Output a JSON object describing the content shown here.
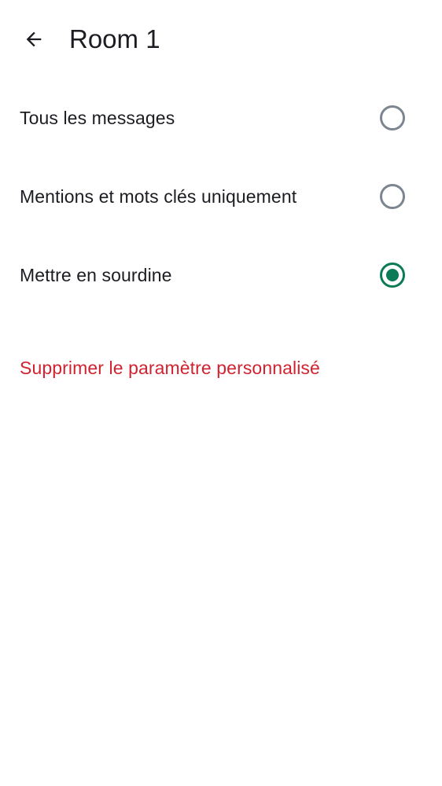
{
  "header": {
    "title": "Room 1",
    "back_icon": "arrow-left-icon"
  },
  "options": [
    {
      "label": "Tous les messages",
      "selected": false
    },
    {
      "label": "Mentions et mots clés uniquement",
      "selected": false
    },
    {
      "label": "Mettre en sourdine",
      "selected": true
    }
  ],
  "remove_custom_label": "Supprimer le paramètre personnalisé",
  "colors": {
    "accent": "#0b7a56",
    "destructive": "#d1222f",
    "radio_unselected": "#7d8590",
    "text": "#1b1d22"
  }
}
